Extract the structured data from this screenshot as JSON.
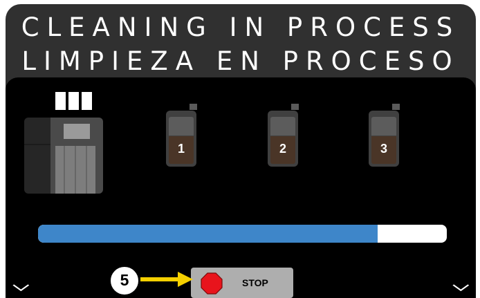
{
  "header": {
    "title_en": "CLEANING IN PROCESS",
    "title_es": "LIMPIEZA EN PROCESO"
  },
  "containers": [
    {
      "label": "1"
    },
    {
      "label": "2"
    },
    {
      "label": "3"
    }
  ],
  "progress": {
    "fraction": 0.83,
    "fill_color": "#3e86c9"
  },
  "stop_button": {
    "label": "STOP",
    "icon": "stop-octagon-icon",
    "icon_color": "#e8141c"
  },
  "callout": {
    "number": "5",
    "arrow_color": "#f5d000"
  },
  "icons": {
    "scroll_left": "double-chevron-down-icon",
    "scroll_right": "double-chevron-down-icon"
  }
}
